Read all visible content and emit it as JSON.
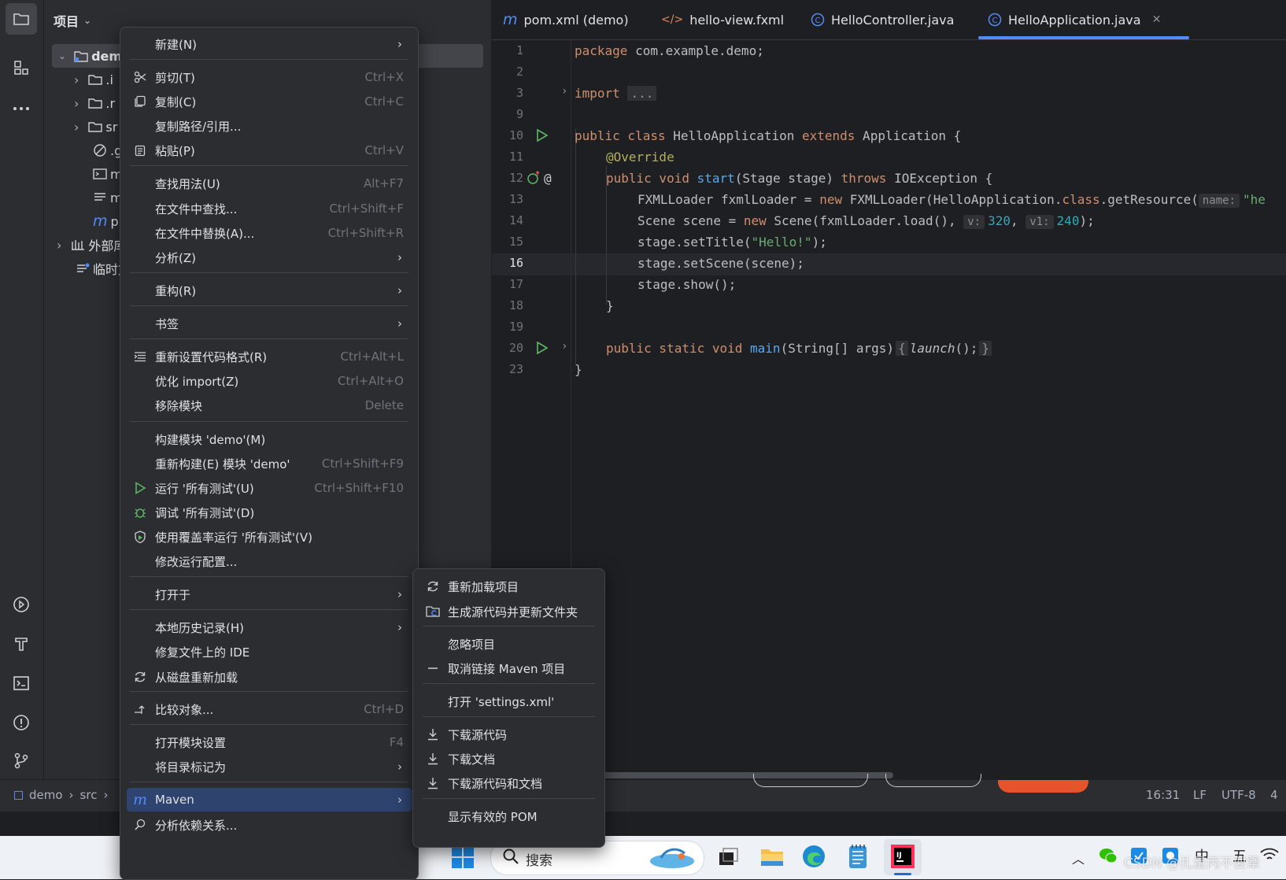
{
  "project": {
    "title": "项目",
    "root_label": "demo",
    "items": [
      ".i",
      ".r",
      "sr",
      ".g",
      "m",
      "m",
      "p",
      "外部库",
      "临时文件"
    ]
  },
  "tabs": [
    {
      "label": "pom.xml (demo)",
      "icon": "maven-icon"
    },
    {
      "label": "hello-view.fxml",
      "icon": "xml-icon"
    },
    {
      "label": "HelloController.java",
      "icon": "class-icon"
    },
    {
      "label": "HelloApplication.java",
      "icon": "class-icon",
      "active": true
    }
  ],
  "editor": {
    "line_numbers": [
      "1",
      "2",
      "3",
      "9",
      "10",
      "11",
      "12",
      "13",
      "14",
      "15",
      "16",
      "17",
      "18",
      "19",
      "20",
      "23"
    ],
    "code": {
      "l1_kw": "package",
      "l1_rest": " com.example.demo;",
      "l3_kw": "import",
      "l3_fold": "...",
      "l10_a": "public class",
      "l10_b": " HelloApplication ",
      "l10_c": "extends",
      "l10_d": " Application {",
      "l11": "@Override",
      "l12_a": "public void",
      "l12_b": "start",
      "l12_c": "(Stage stage) ",
      "l12_d": "throws",
      "l12_e": " IOException {",
      "l13_a": "FXMLLoader fxmlLoader = ",
      "l13_b": "new",
      "l13_c": " FXMLLoader(HelloApplication.",
      "l13_d": "class",
      "l13_e": ".getResource(",
      "l13_hint": "name:",
      "l13_str": "\"he",
      "l14_a": "Scene scene = ",
      "l14_b": "new",
      "l14_c": " Scene(fxmlLoader.load(), ",
      "l14_h1": "v:",
      "l14_n1": "320",
      "l14_sep": ", ",
      "l14_h2": "v1:",
      "l14_n2": "240",
      "l14_end": ");",
      "l15_a": "stage.setTitle(",
      "l15_str": "\"Hello!\"",
      "l15_end": ");",
      "l16": "stage.setScene(scene);",
      "l17": "stage.show();",
      "l18": "}",
      "l20_a": "public static void",
      "l20_b": "main",
      "l20_c": "(String[] args)",
      "l20_d": "{",
      "l20_e": "launch",
      "l20_f": "();",
      "l20_g": "}",
      "l23": "}"
    }
  },
  "statusbar": {
    "breadcrumb": [
      "demo",
      "src"
    ],
    "position": "16:31",
    "line_sep": "LF",
    "encoding": "UTF-8",
    "indent": "4"
  },
  "context_menu": {
    "items": [
      {
        "label": "新建(N)",
        "submenu": true
      },
      {
        "label": "剪切(T)",
        "shortcut": "Ctrl+X",
        "icon": "scissors-icon"
      },
      {
        "label": "复制(C)",
        "shortcut": "Ctrl+C",
        "icon": "copy-icon"
      },
      {
        "label": "复制路径/引用..."
      },
      {
        "label": "粘贴(P)",
        "shortcut": "Ctrl+V",
        "icon": "paste-icon"
      },
      {
        "label": "查找用法(U)",
        "shortcut": "Alt+F7"
      },
      {
        "label": "在文件中查找...",
        "shortcut": "Ctrl+Shift+F"
      },
      {
        "label": "在文件中替换(A)...",
        "shortcut": "Ctrl+Shift+R"
      },
      {
        "label": "分析(Z)",
        "submenu": true
      },
      {
        "label": "重构(R)",
        "submenu": true
      },
      {
        "label": "书签",
        "submenu": true
      },
      {
        "label": "重新设置代码格式(R)",
        "shortcut": "Ctrl+Alt+L",
        "icon": "format-icon"
      },
      {
        "label": "优化 import(Z)",
        "shortcut": "Ctrl+Alt+O"
      },
      {
        "label": "移除模块",
        "shortcut": "Delete"
      },
      {
        "label": "构建模块 'demo'(M)"
      },
      {
        "label": "重新构建(E) 模块 'demo'",
        "shortcut": "Ctrl+Shift+F9"
      },
      {
        "label": "运行 '所有测试'(U)",
        "shortcut": "Ctrl+Shift+F10",
        "icon": "run-icon"
      },
      {
        "label": "调试 '所有测试'(D)",
        "icon": "debug-icon"
      },
      {
        "label": "使用覆盖率运行 '所有测试'(V)",
        "icon": "coverage-icon"
      },
      {
        "label": "修改运行配置..."
      },
      {
        "label": "打开于",
        "submenu": true
      },
      {
        "label": "本地历史记录(H)",
        "submenu": true
      },
      {
        "label": "修复文件上的 IDE"
      },
      {
        "label": "从磁盘重新加载",
        "icon": "reload-icon"
      },
      {
        "label": "比较对象...",
        "shortcut": "Ctrl+D",
        "icon": "compare-icon"
      },
      {
        "label": "打开模块设置",
        "shortcut": "F4"
      },
      {
        "label": "将目录标记为",
        "submenu": true
      },
      {
        "label": "Maven",
        "submenu": true,
        "icon": "maven-icon",
        "highlighted": true
      },
      {
        "label": "分析依赖关系...",
        "icon": "dependency-icon"
      }
    ]
  },
  "maven_submenu": {
    "items": [
      {
        "label": "重新加载项目",
        "icon": "reload-icon"
      },
      {
        "label": "生成源代码并更新文件夹",
        "icon": "generate-folder-icon"
      },
      {
        "label": "忽略项目"
      },
      {
        "label": "取消链接 Maven 项目",
        "icon": "minus-icon"
      },
      {
        "label": "打开 'settings.xml'"
      },
      {
        "label": "下载源代码",
        "icon": "download-icon"
      },
      {
        "label": "下载文档",
        "icon": "download-icon"
      },
      {
        "label": "下载源代码和文档",
        "icon": "download-icon"
      },
      {
        "label": "显示有效的 POM"
      }
    ]
  },
  "taskbar": {
    "search_placeholder": "搜索",
    "tray": {
      "ime": "中",
      "ime2": "五",
      "watermark": "CSDN @扎量丙不要犟"
    }
  }
}
